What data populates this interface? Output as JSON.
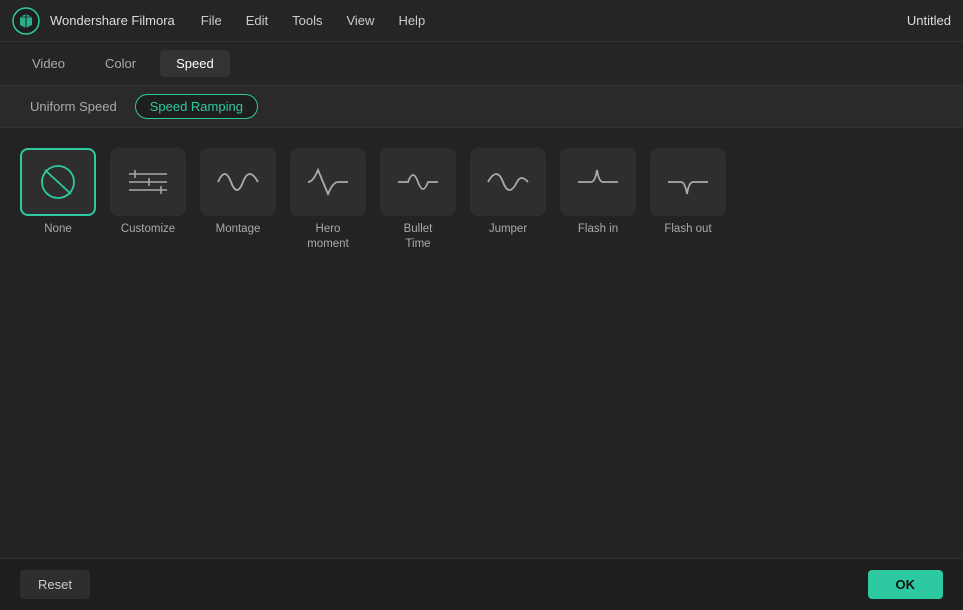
{
  "menubar": {
    "brand": "Wondershare Filmora",
    "title": "Untitled",
    "items": [
      {
        "label": "File",
        "name": "file-menu"
      },
      {
        "label": "Edit",
        "name": "edit-menu"
      },
      {
        "label": "Tools",
        "name": "tools-menu"
      },
      {
        "label": "View",
        "name": "view-menu"
      },
      {
        "label": "Help",
        "name": "help-menu"
      }
    ]
  },
  "tabs": [
    {
      "label": "Video",
      "name": "tab-video",
      "active": false
    },
    {
      "label": "Color",
      "name": "tab-color",
      "active": false
    },
    {
      "label": "Speed",
      "name": "tab-speed",
      "active": true
    }
  ],
  "subtabs": [
    {
      "label": "Uniform Speed",
      "name": "subtab-uniform",
      "active": false
    },
    {
      "label": "Speed Ramping",
      "name": "subtab-ramping",
      "active": true
    }
  ],
  "presets": [
    {
      "label": "None",
      "name": "preset-none",
      "selected": true,
      "type": "none"
    },
    {
      "label": "Customize",
      "name": "preset-customize",
      "selected": false,
      "type": "customize"
    },
    {
      "label": "Montage",
      "name": "preset-montage",
      "selected": false,
      "type": "montage"
    },
    {
      "label": "Hero\nmoment",
      "name": "preset-hero",
      "selected": false,
      "type": "hero"
    },
    {
      "label": "Bullet\nTime",
      "name": "preset-bullet",
      "selected": false,
      "type": "bullet"
    },
    {
      "label": "Jumper",
      "name": "preset-jumper",
      "selected": false,
      "type": "jumper"
    },
    {
      "label": "Flash in",
      "name": "preset-flash-in",
      "selected": false,
      "type": "flash-in"
    },
    {
      "label": "Flash out",
      "name": "preset-flash-out",
      "selected": false,
      "type": "flash-out"
    }
  ],
  "buttons": {
    "reset": "Reset",
    "ok": "OK"
  }
}
